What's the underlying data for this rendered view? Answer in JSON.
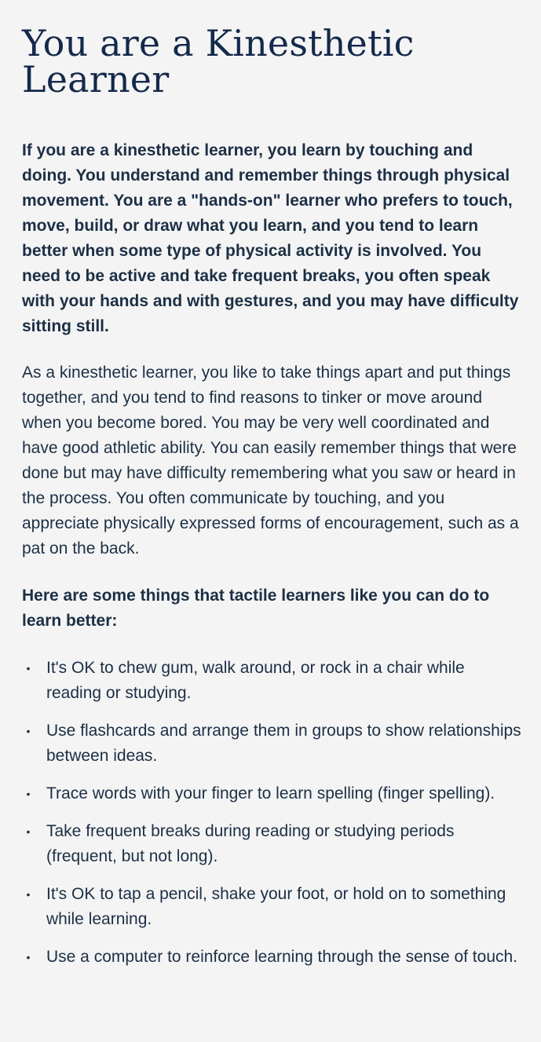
{
  "page": {
    "title": "You are a Kinesthetic Learner",
    "intro": "If you are a kinesthetic learner, you learn by touching and doing. You understand and remember things through physical movement. You are a \"hands-on\" learner who prefers to touch, move, build, or draw what you learn, and you tend to learn better when some type of physical activity is involved. You need to be active and take frequent breaks, you often speak with your hands and with gestures, and you may have difficulty sitting still.",
    "body": "As a kinesthetic learner, you like to take things apart and put things together, and you tend to find reasons to tinker or move around when you become bored. You may be very well coordinated and have good athletic ability. You can easily remember things that were done but may have difficulty remembering what you saw or heard in the process. You often communicate by touching, and you appreciate physically expressed forms of encouragement, such as a pat on the back.",
    "tips_heading": "Here are some things that tactile learners like you can do to learn better:",
    "bullet_glyph": "•",
    "tips": [
      "It's OK to chew gum, walk around, or rock in a chair while reading or studying.",
      "Use flashcards and arrange them in groups to show relationships between ideas.",
      "Trace words with your finger to learn spelling (finger spelling).",
      "Take frequent breaks during reading or studying periods (frequent, but not long).",
      "It's OK to tap a pencil, shake your foot, or hold on to something while learning.",
      "Use a computer to reinforce learning through the sense of touch."
    ]
  },
  "colors": {
    "background": "#f4f4f4",
    "title": "#14294a",
    "text": "#1c2f45"
  }
}
